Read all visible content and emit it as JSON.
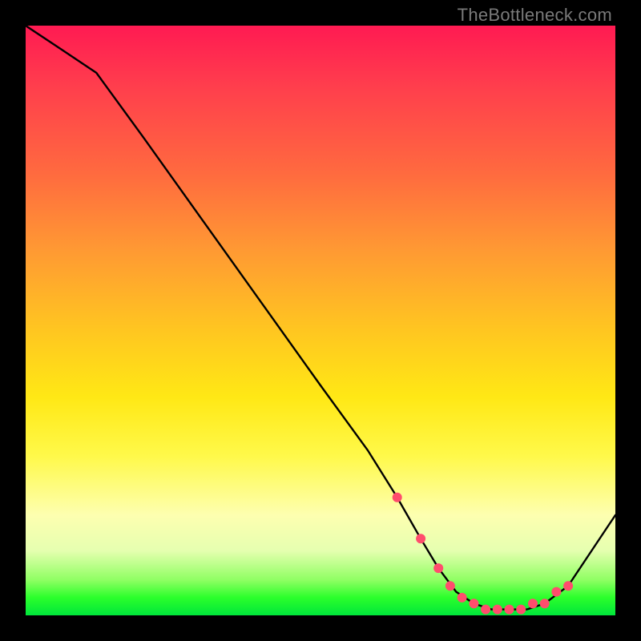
{
  "watermark": "TheBottleneck.com",
  "chart_data": {
    "type": "line",
    "title": "",
    "xlabel": "",
    "ylabel": "",
    "xlim": [
      0,
      100
    ],
    "ylim": [
      0,
      100
    ],
    "series": [
      {
        "name": "bottleneck-curve",
        "x": [
          0,
          6,
          12,
          20,
          30,
          40,
          50,
          58,
          63,
          67,
          70,
          73,
          76,
          79,
          82,
          85,
          88,
          92,
          100
        ],
        "values": [
          100,
          96,
          92,
          81,
          67,
          53,
          39,
          28,
          20,
          13,
          8,
          4,
          2,
          1,
          1,
          1,
          2,
          5,
          17
        ]
      }
    ],
    "markers": {
      "name": "highlight-dots",
      "x": [
        63,
        67,
        70,
        72,
        74,
        76,
        78,
        80,
        82,
        84,
        86,
        88,
        90,
        92
      ],
      "values": [
        20,
        13,
        8,
        5,
        3,
        2,
        1,
        1,
        1,
        1,
        2,
        2,
        4,
        5
      ],
      "color": "#ff4d6d"
    }
  }
}
